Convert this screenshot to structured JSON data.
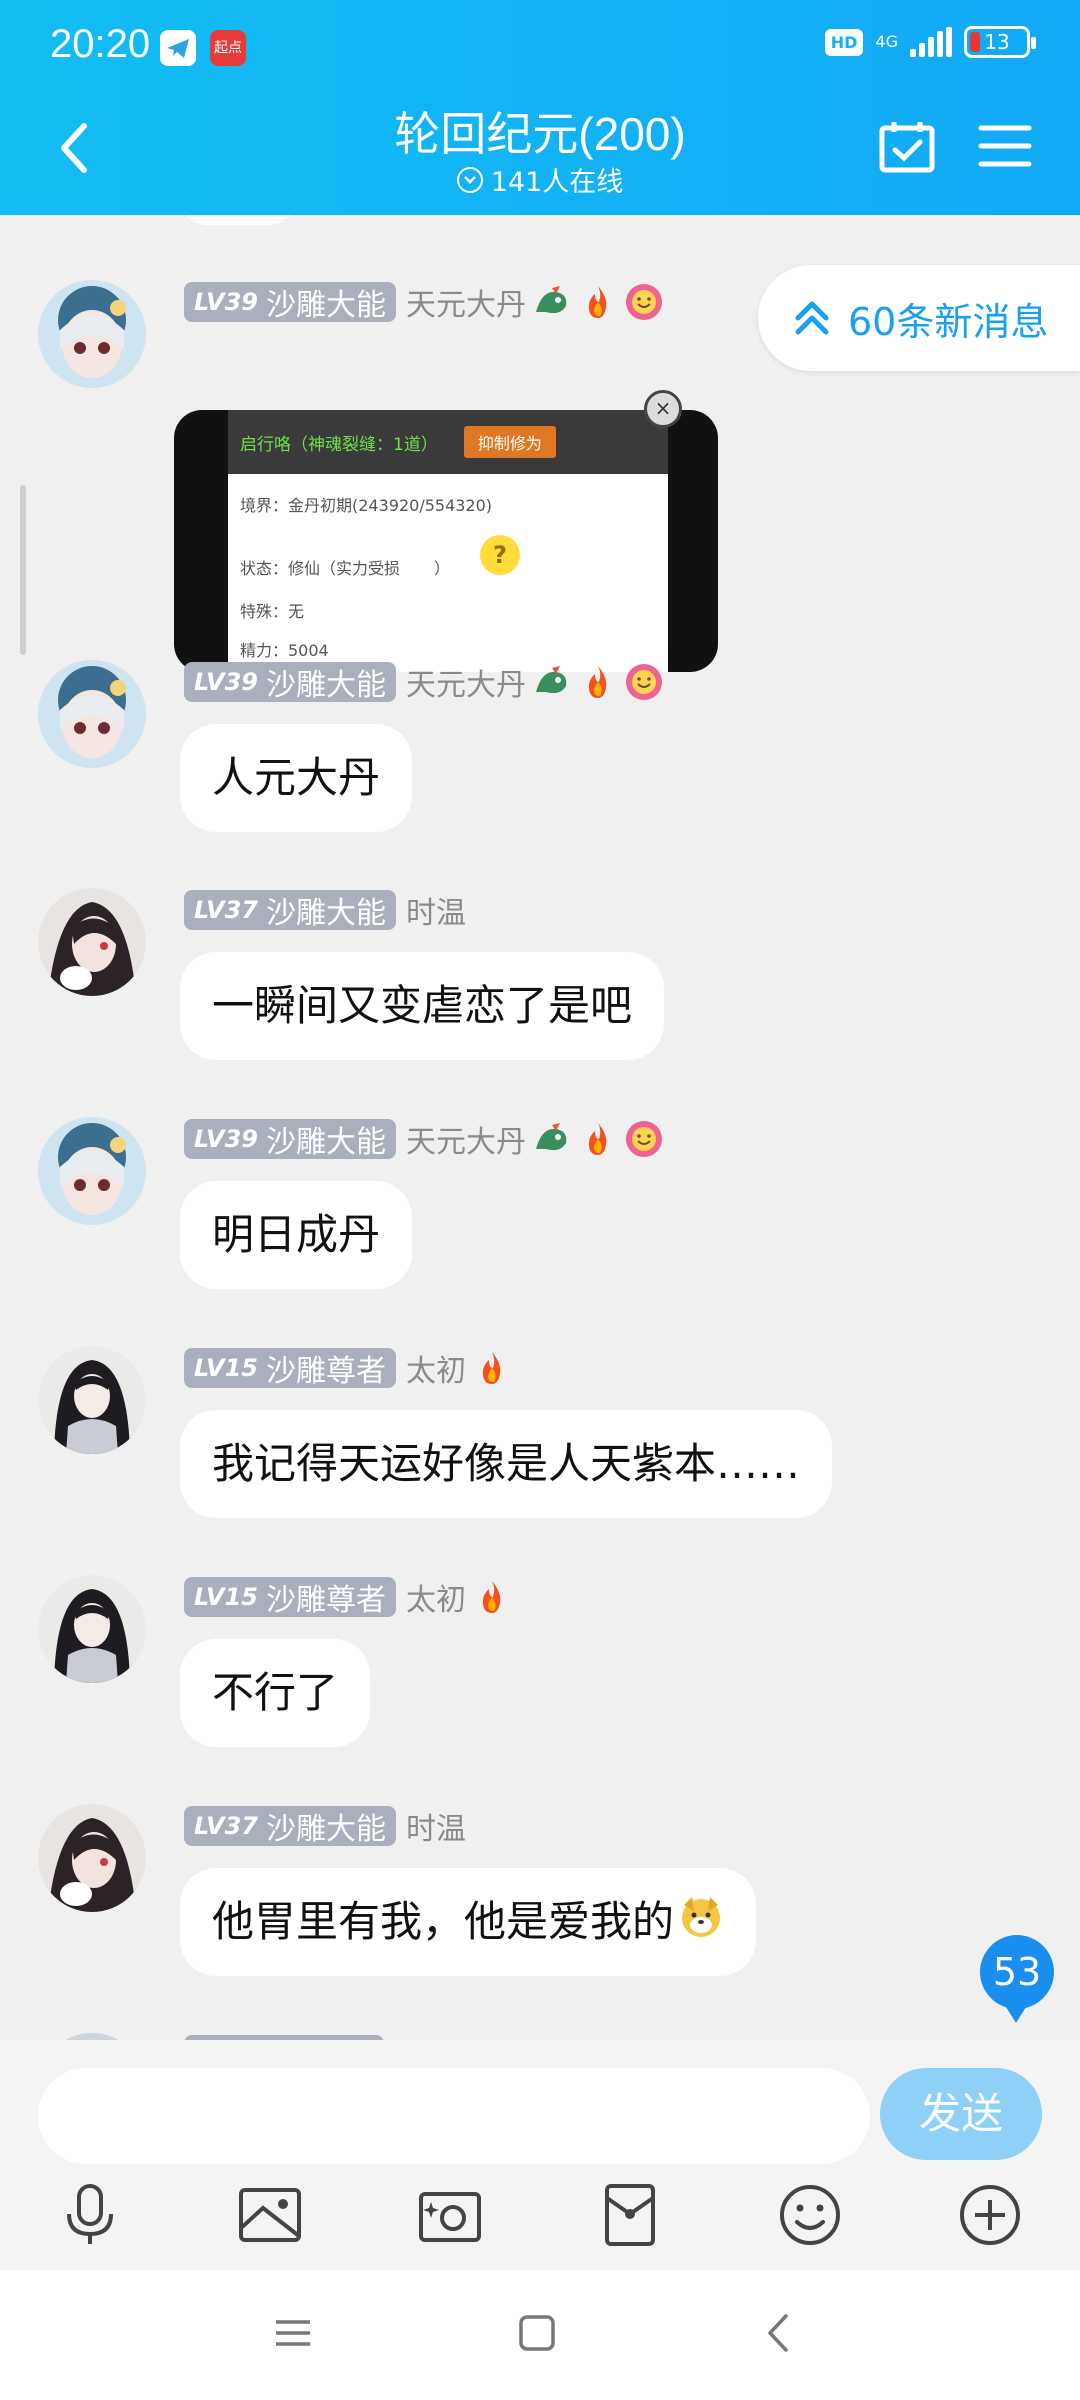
{
  "status_bar": {
    "time": "20:20",
    "app_badge_1": "telegram-app-icon",
    "app_badge_2": "起点",
    "hd": "HD",
    "network": "4G",
    "battery": "13"
  },
  "header": {
    "title": "轮回纪元(200)",
    "online": "141人在线",
    "icons": [
      "back-icon",
      "calendar-check-icon",
      "menu-icon"
    ]
  },
  "new_messages_pill": "60条新消息",
  "image_message": {
    "top_text": "启行咯（神魂裂缝：1道）",
    "top_button": "抑制修为",
    "line1": "境界：金丹初期(243920/554320)",
    "line2": "状态：修仙（实力受损",
    "line2_end": "）",
    "line3": "特殊：无",
    "line4": "精力：5004"
  },
  "messages": [
    {
      "level": "LV39",
      "title": "沙雕大能",
      "nick": "天元大丹",
      "text": ""
    },
    {
      "level": "LV39",
      "title": "沙雕大能",
      "nick": "天元大丹",
      "text": "人元大丹"
    },
    {
      "level": "LV37",
      "title": "沙雕大能",
      "nick": "时温",
      "text": "一瞬间又变虐恋了是吧"
    },
    {
      "level": "LV39",
      "title": "沙雕大能",
      "nick": "天元大丹",
      "text": "明日成丹"
    },
    {
      "level": "LV15",
      "title": "沙雕尊者",
      "nick": "太初",
      "text": "我记得天运好像是人天紫本……"
    },
    {
      "level": "LV15",
      "title": "沙雕尊者",
      "nick": "太初",
      "text": "不行了"
    },
    {
      "level": "LV37",
      "title": "沙雕大能",
      "nick": "时温",
      "text": "他胃里有我，他是爱我的"
    }
  ],
  "unread_badge": "53",
  "input": {
    "placeholder": "",
    "send_label": "发送"
  },
  "toolbar_icons": [
    "microphone-icon",
    "image-icon",
    "camera-icon",
    "red-packet-icon",
    "emoji-icon",
    "plus-icon"
  ],
  "nav_icons": [
    "recent-apps-icon",
    "home-icon",
    "back-nav-icon"
  ],
  "colors": {
    "header": "#12b4f4",
    "accent": "#19a0f0",
    "level_badge": "#a9afbc"
  }
}
